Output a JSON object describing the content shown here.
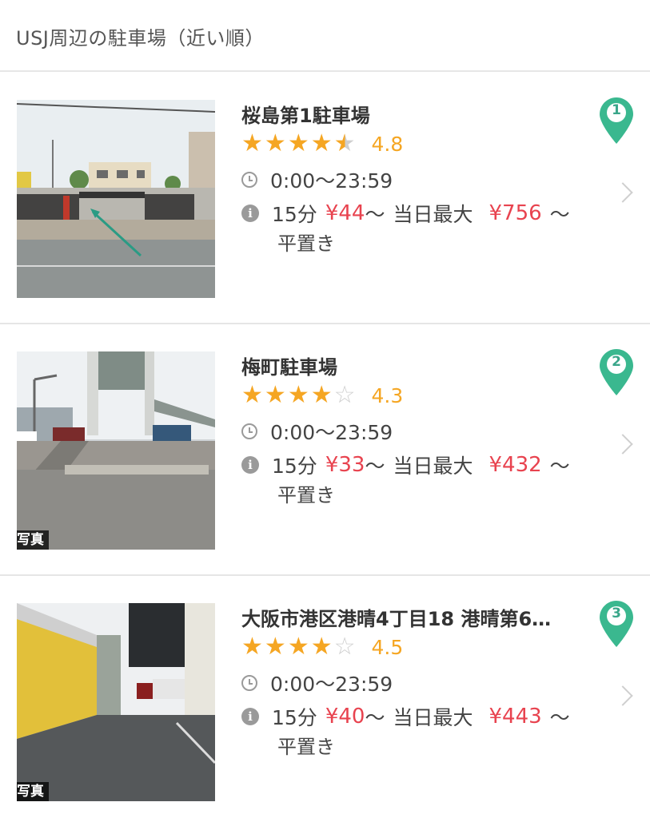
{
  "header": {
    "title": "USJ周辺の駐車場（近い順）"
  },
  "accent": {
    "star": "#f5a623",
    "price": "#e8434f",
    "pin": "#3ab88f"
  },
  "lots": [
    {
      "rank": "1",
      "name": "桜島第1駐車場",
      "stars": [
        "full",
        "full",
        "full",
        "full",
        "half"
      ],
      "rating": "4.8",
      "hours": "0:00〜23:59",
      "per15": "15分",
      "price15": "¥44",
      "tilde": "〜",
      "daily_label": "当日最大",
      "daily_max": "¥756",
      "type": "平置き",
      "photo_caption": ""
    },
    {
      "rank": "2",
      "name": "梅町駐車場",
      "stars": [
        "full",
        "full",
        "full",
        "full",
        "empty"
      ],
      "rating": "4.3",
      "hours": "0:00〜23:59",
      "per15": "15分",
      "price15": "¥33",
      "tilde": "〜",
      "daily_label": "当日最大",
      "daily_max": "¥432",
      "type": "平置き",
      "photo_caption": "写真"
    },
    {
      "rank": "3",
      "name": "大阪市港区港晴4丁目18 港晴第6…",
      "stars": [
        "full",
        "full",
        "full",
        "full",
        "empty"
      ],
      "rating": "4.5",
      "hours": "0:00〜23:59",
      "per15": "15分",
      "price15": "¥40",
      "tilde": "〜",
      "daily_label": "当日最大",
      "daily_max": "¥443",
      "type": "平置き",
      "photo_caption": "写真"
    }
  ]
}
